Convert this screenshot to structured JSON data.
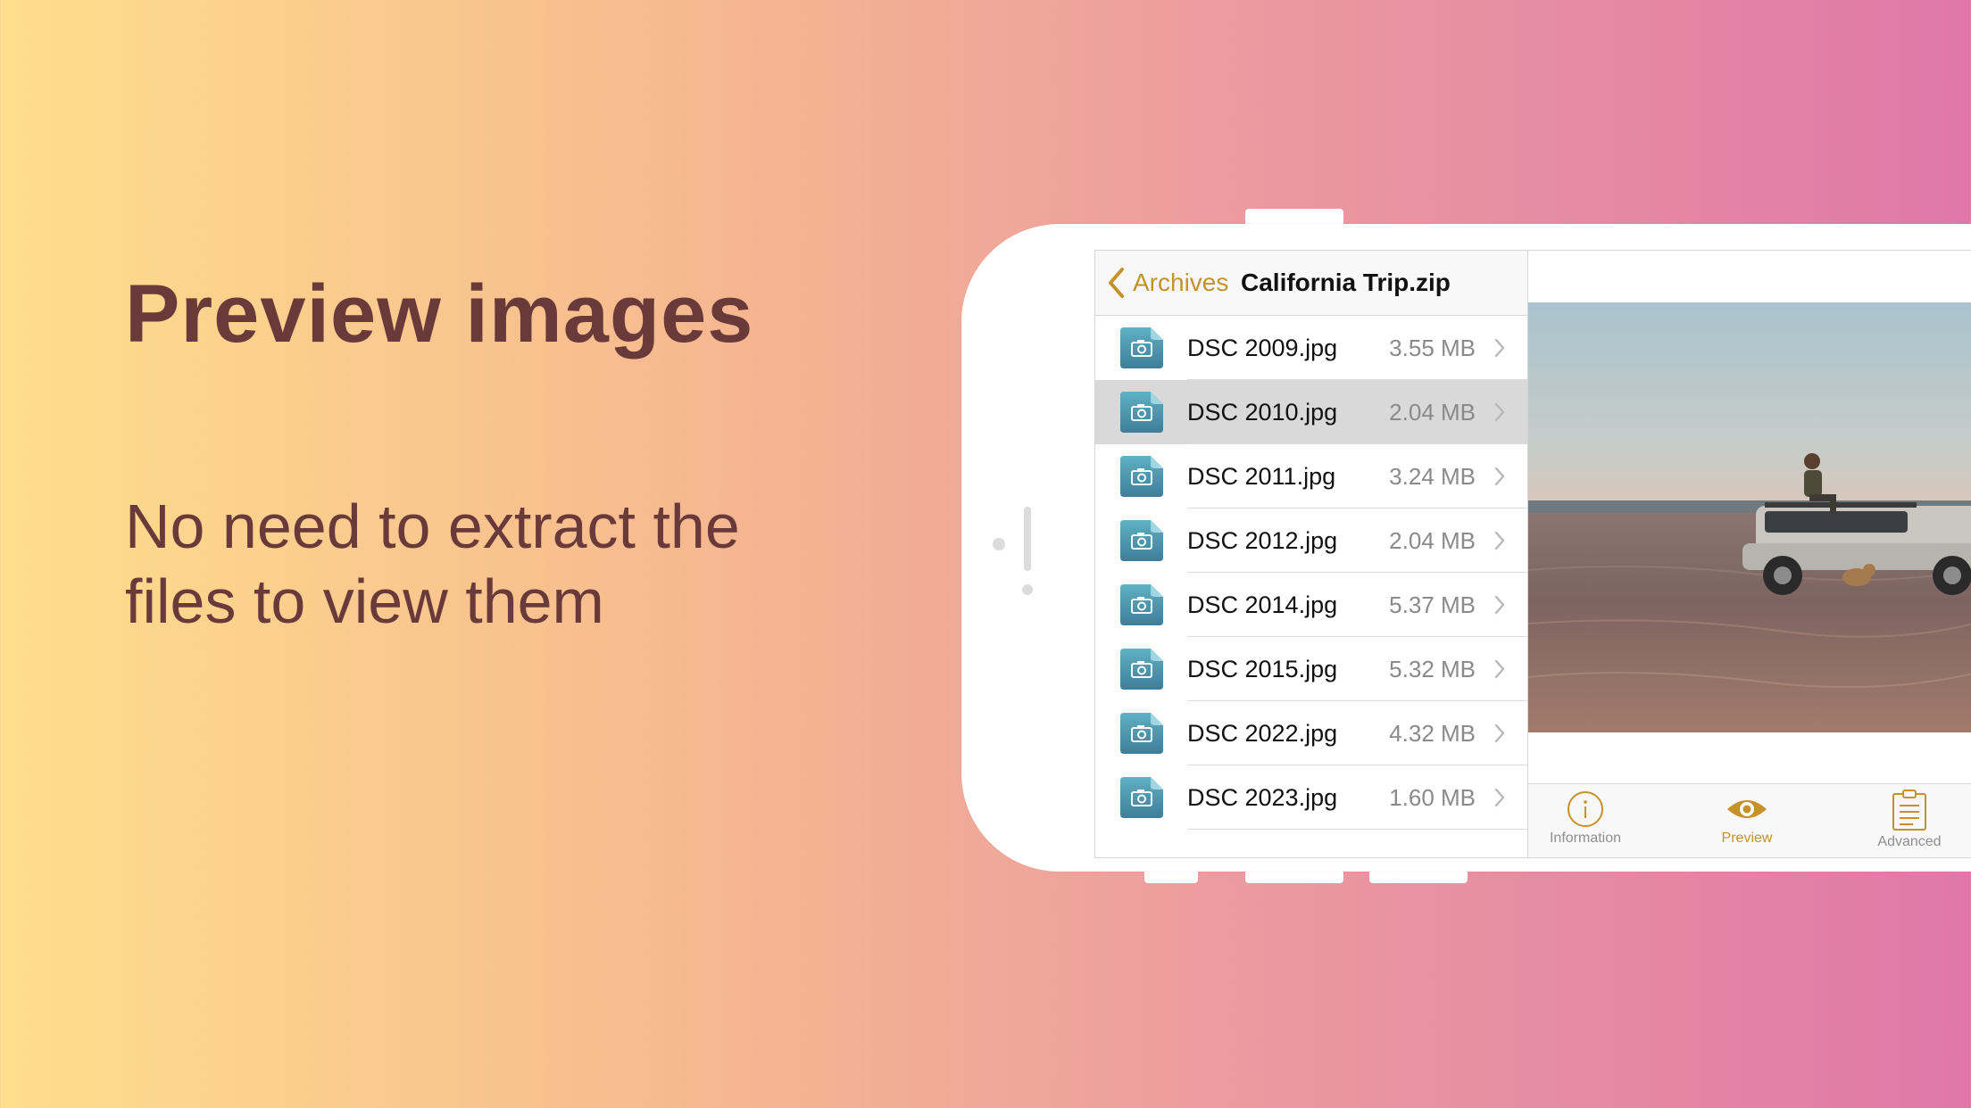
{
  "promo": {
    "headline": "Preview images",
    "subline": "No need to extract the files to view them"
  },
  "navbar": {
    "back_label": "Archives",
    "title": "California Trip.zip"
  },
  "files": [
    {
      "name": "DSC 2009.jpg",
      "size": "3.55 MB",
      "selected": false
    },
    {
      "name": "DSC 2010.jpg",
      "size": "2.04 MB",
      "selected": true
    },
    {
      "name": "DSC 2011.jpg",
      "size": "3.24 MB",
      "selected": false
    },
    {
      "name": "DSC 2012.jpg",
      "size": "2.04 MB",
      "selected": false
    },
    {
      "name": "DSC 2014.jpg",
      "size": "5.37 MB",
      "selected": false
    },
    {
      "name": "DSC 2015.jpg",
      "size": "5.32 MB",
      "selected": false
    },
    {
      "name": "DSC 2022.jpg",
      "size": "4.32 MB",
      "selected": false
    },
    {
      "name": "DSC 2023.jpg",
      "size": "1.60 MB",
      "selected": false
    }
  ],
  "tabs": [
    {
      "label": "Information",
      "icon": "info-icon",
      "active": false
    },
    {
      "label": "Preview",
      "icon": "eye-icon",
      "active": true
    },
    {
      "label": "Advanced",
      "icon": "clipboard-icon",
      "active": false
    }
  ],
  "colors": {
    "accent": "#c5922a",
    "text_primary": "#6a3a3a",
    "file_icon": "#4f8fa8"
  }
}
